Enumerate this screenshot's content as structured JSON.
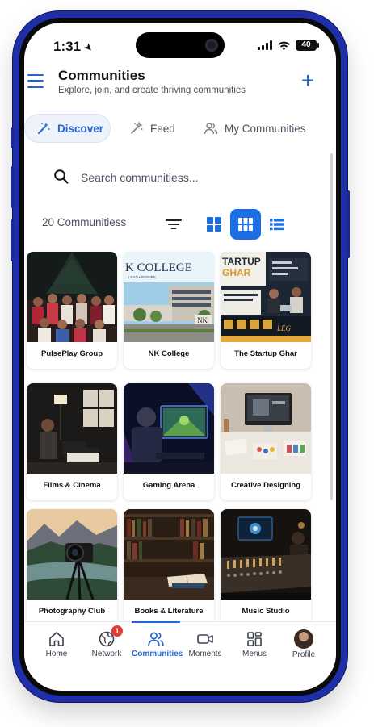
{
  "status_bar": {
    "time": "1:31",
    "battery": "40"
  },
  "header": {
    "title": "Communities",
    "subtitle": "Explore, join, and create thriving communities"
  },
  "tabs": [
    {
      "label": "Discover",
      "icon": "magic-wand-icon",
      "active": true
    },
    {
      "label": "Feed",
      "icon": "magic-wand-icon",
      "active": false
    },
    {
      "label": "My Communities",
      "icon": "users-icon",
      "active": false
    }
  ],
  "search": {
    "placeholder": "Search communitiess..."
  },
  "toolbar": {
    "count_label": "20 Communitiess",
    "active_view": "grid"
  },
  "communities": [
    {
      "name": "PulsePlay Group"
    },
    {
      "name": "NK College"
    },
    {
      "name": "The Startup Ghar"
    },
    {
      "name": "Films & Cinema"
    },
    {
      "name": "Gaming Arena"
    },
    {
      "name": "Creative Designing"
    },
    {
      "name": "Photography Club"
    },
    {
      "name": "Books & Literature"
    },
    {
      "name": "Music Studio"
    }
  ],
  "bottom_nav": [
    {
      "label": "Home",
      "icon": "home-icon"
    },
    {
      "label": "Network",
      "icon": "globe-icon",
      "badge": "1"
    },
    {
      "label": "Communities",
      "icon": "users-icon",
      "active": true
    },
    {
      "label": "Moments",
      "icon": "video-icon"
    },
    {
      "label": "Menus",
      "icon": "grid-icon"
    },
    {
      "label": "Profile",
      "icon": "avatar"
    }
  ],
  "colors": {
    "accent": "#2366d1",
    "frame": "#1f2fa8",
    "badge": "#e53935"
  }
}
